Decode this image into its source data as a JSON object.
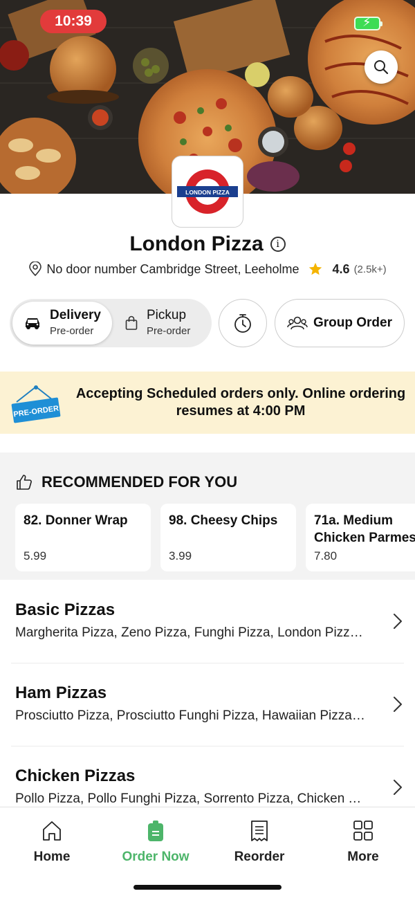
{
  "status_bar": {
    "time": "10:39"
  },
  "store": {
    "logo_text": "LONDON PIZZA",
    "name": "London Pizza",
    "address": "No door number  Cambridge Street, Leeholme",
    "rating": "4.6",
    "rating_count": "(2.5k+)"
  },
  "order_mode": {
    "delivery_label": "Delivery",
    "delivery_sub": "Pre-order",
    "pickup_label": "Pickup",
    "pickup_sub": "Pre-order",
    "group_order_label": "Group Order"
  },
  "notice": {
    "sign_label": "PRE-ORDER",
    "message": "Accepting Scheduled orders only. Online ordering resumes at 4:00 PM"
  },
  "recommended": {
    "title": "RECOMMENDED FOR YOU",
    "items": [
      {
        "name": "82. Donner Wrap",
        "price": "5.99"
      },
      {
        "name": "98. Cheesy Chips",
        "price": "3.99"
      },
      {
        "name": "71a. Medium Chicken Parmes",
        "name_line1": "71a. Medium",
        "name_line2": "Chicken Parmes",
        "price": "7.80"
      }
    ]
  },
  "categories": [
    {
      "title": "Basic Pizzas",
      "items": "Margherita Pizza, Zeno Pizza, Funghi Pizza, London Pizza, Pepperoni Pizza"
    },
    {
      "title": "Ham Pizzas",
      "items": "Prosciutto Pizza, Prosciutto Funghi Pizza, Hawaiian Pizza, Calzone"
    },
    {
      "title": "Chicken Pizzas",
      "items": "Pollo Pizza, Pollo Funghi Pizza, Sorrento Pizza, Chicken Tikka Pizza"
    }
  ],
  "bottom_nav": [
    {
      "label": "Home",
      "icon": "home-icon"
    },
    {
      "label": "Order Now",
      "icon": "order-bag-icon"
    },
    {
      "label": "Reorder",
      "icon": "receipt-icon"
    },
    {
      "label": "More",
      "icon": "grid-icon"
    }
  ],
  "colors": {
    "accent_green": "#4db56a",
    "notice_bg": "#fcf2d3",
    "logo_red": "#d8232a",
    "logo_blue": "#1b3f8f",
    "status_red": "#e23b3b"
  }
}
